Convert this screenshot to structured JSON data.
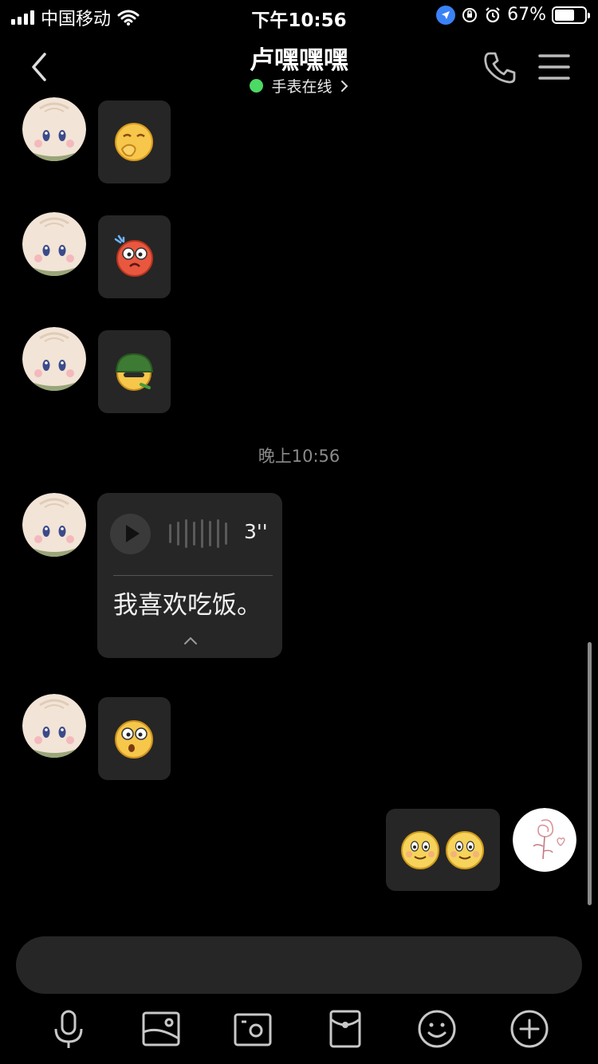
{
  "status_bar": {
    "carrier": "中国移动",
    "time": "下午10:56",
    "battery_percent": "67%",
    "battery_level": 0.67,
    "icons": [
      "signal-icon",
      "wifi-icon",
      "location-icon",
      "rotation-lock-icon",
      "alarm-icon",
      "battery-icon"
    ]
  },
  "header": {
    "title": "卢嘿嘿嘿",
    "presence": "手表在线",
    "presence_color": "#4cd964"
  },
  "messages": {
    "timestamp": "晚上10:56",
    "voice": {
      "duration": "3''",
      "transcript": "我喜欢吃饭。"
    },
    "stickers": [
      "covering-mouth-emoji",
      "shocked-red-face-emoji",
      "green-helmet-emoji",
      "surprised-emoji",
      "blush-smile-emoji",
      "blush-smile-emoji"
    ]
  },
  "input": {
    "placeholder": ""
  },
  "toolbar": {
    "items": [
      "microphone-icon",
      "photo-icon",
      "camera-icon",
      "red-packet-icon",
      "emoji-icon",
      "plus-icon"
    ]
  },
  "colors": {
    "background": "#000000",
    "bubble": "#262626",
    "accent_green": "#4cd964"
  }
}
